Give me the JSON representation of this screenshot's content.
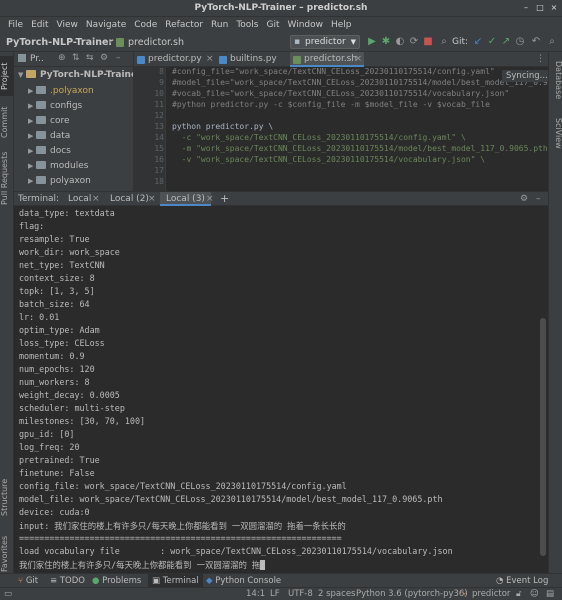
{
  "window": {
    "title": "PyTorch-NLP-Trainer – predictor.sh",
    "minimize": "–",
    "maximize": "□",
    "close": "×"
  },
  "menu": [
    "File",
    "Edit",
    "View",
    "Navigate",
    "Code",
    "Refactor",
    "Run",
    "Tools",
    "Git",
    "Window",
    "Help"
  ],
  "navbar": {
    "project": "PyTorch-NLP-Trainer",
    "file": "predictor.sh",
    "run_config": "predictor",
    "git_label": "Git:"
  },
  "left_strip": [
    "Project",
    "Commit",
    "Pull Requests",
    "Structure",
    "Favorites"
  ],
  "right_strip": [
    "Database",
    "SciView"
  ],
  "project_panel": {
    "header": "Pr..",
    "root": "PyTorch-NLP-Trainer",
    "items": [
      ".polyaxon",
      "configs",
      "core",
      "data",
      "docs",
      "modules",
      "polyaxon"
    ]
  },
  "editor": {
    "tabs": [
      "predictor.py",
      "builtins.py",
      "predictor.sh"
    ],
    "syncing": "Syncing...",
    "line_numbers": [
      "8",
      "9",
      "10",
      "11",
      "12",
      "13",
      "14",
      "15",
      "16",
      "17",
      "18"
    ],
    "lines": [
      "#config_file=\"work_space/TextCNN_CELoss_20230110175514/config.yaml\"",
      "#model_file=\"work_space/TextCNN_CELoss_20230110175514/model/best_model_117_0.9065",
      "#vocab_file=\"work_space/TextCNN_CELoss_20230110175514/vocabulary.json\"",
      "#python predictor.py -c $config_file -m $model_file -v $vocab_file",
      "",
      "python predictor.py \\",
      "  -c \"work_space/TextCNN_CELoss_20230110175514/config.yaml\" \\",
      "  -m \"work_space/TextCNN_CELoss_20230110175514/model/best_model_117_0.9065.pth\" \\",
      "  -v \"work_space/TextCNN_CELoss_20230110175514/vocabulary.json\" \\",
      "",
      ""
    ]
  },
  "terminal": {
    "label": "Terminal:",
    "tabs": [
      "Local",
      "Local (2)",
      "Local (3)"
    ],
    "add": "+",
    "lines": [
      "data_type: textdata",
      "flag:",
      "resample: True",
      "work_dir: work_space",
      "net_type: TextCNN",
      "context_size: 8",
      "topk: [1, 3, 5]",
      "batch_size: 64",
      "lr: 0.01",
      "optim_type: Adam",
      "loss_type: CELoss",
      "momentum: 0.9",
      "num_epochs: 120",
      "num_workers: 8",
      "weight_decay: 0.0005",
      "scheduler: multi-step",
      "milestones: [30, 70, 100]",
      "gpu_id: [0]",
      "log_freq: 20",
      "pretrained: True",
      "finetune: False",
      "config_file: work_space/TextCNN_CELoss_20230110175514/config.yaml",
      "model_file: work_space/TextCNN_CELoss_20230110175514/model/best_model_117_0.9065.pth",
      "device: cuda:0",
      "input: 我们家住的楼上有许多只/每天晚上你都能看到 一双圆溜溜的 拖着一条长长的",
      "================================================================",
      "load vocabulary file        : work_space/TextCNN_CELoss_20230110175514/vocabulary.json",
      "我们家住的楼上有许多只/每天晚上你都能看到 一双圆溜溜的 拖"
    ]
  },
  "bottom_tools": [
    "Git",
    "TODO",
    "Problems",
    "Terminal",
    "Python Console",
    "Event Log"
  ],
  "status": {
    "position": "14:1",
    "line_sep": "LF",
    "encoding": "UTF-8",
    "indent": "2 spaces",
    "interpreter": "Python 3.6 (pytorch-py36)",
    "branch": "predictor"
  },
  "colors": {
    "accent": "#4a88c7",
    "comment": "#808080",
    "string": "#6a8759"
  }
}
